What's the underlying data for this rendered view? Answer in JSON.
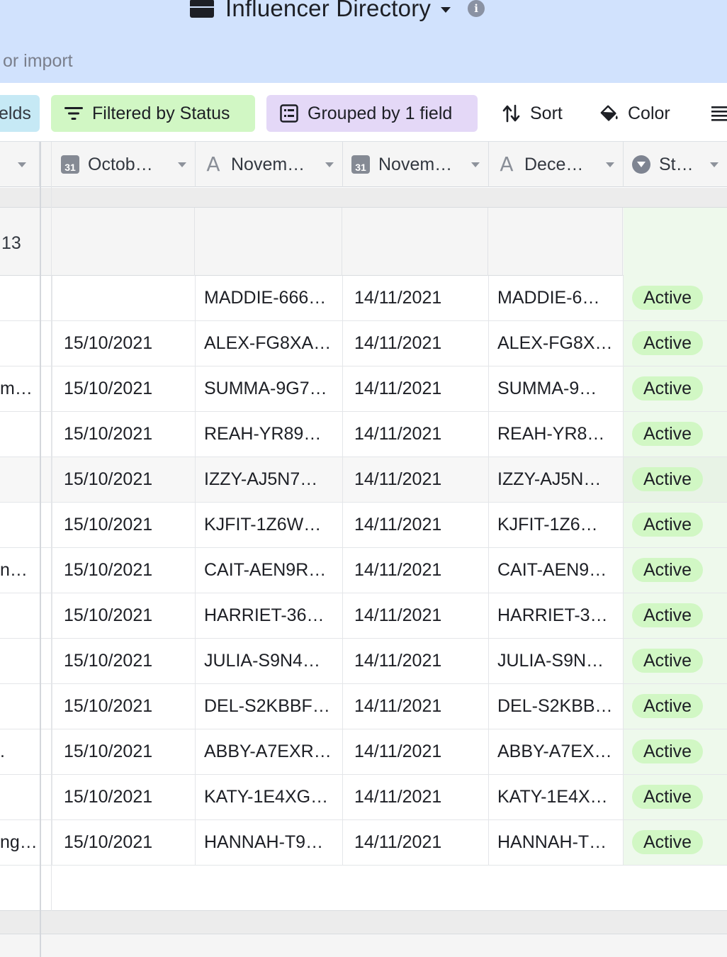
{
  "header": {
    "title": "Influencer Directory",
    "import_text": "or import"
  },
  "toolbar": {
    "fields_label": "elds",
    "filter_label": "Filtered by Status",
    "group_label": "Grouped by 1 field",
    "sort_label": "Sort",
    "color_label": "Color"
  },
  "columns": {
    "oct": "Octob…",
    "nov1": "Novem…",
    "nov2": "Novem…",
    "dec": "Dece…",
    "status": "St…"
  },
  "group": {
    "count": "13"
  },
  "rows": [
    {
      "left": "",
      "oct": "",
      "nov1": "MADDIE-666…",
      "nov2": "14/11/2021",
      "dec": "MADDIE-6…",
      "status": "Active"
    },
    {
      "left": "",
      "oct": "15/10/2021",
      "nov1": "ALEX-FG8XA…",
      "nov2": "14/11/2021",
      "dec": "ALEX-FG8X…",
      "status": "Active"
    },
    {
      "left": "m…",
      "oct": "15/10/2021",
      "nov1": "SUMMA-9G7…",
      "nov2": "14/11/2021",
      "dec": "SUMMA-9…",
      "status": "Active"
    },
    {
      "left": "",
      "oct": "15/10/2021",
      "nov1": "REAH-YR89…",
      "nov2": "14/11/2021",
      "dec": "REAH-YR8…",
      "status": "Active"
    },
    {
      "left": "",
      "oct": "15/10/2021",
      "nov1": "IZZY-AJ5N7…",
      "nov2": "14/11/2021",
      "dec": "IZZY-AJ5N…",
      "status": "Active"
    },
    {
      "left": "",
      "oct": "15/10/2021",
      "nov1": "KJFIT-1Z6W…",
      "nov2": "14/11/2021",
      "dec": "KJFIT-1Z6…",
      "status": "Active"
    },
    {
      "left": "n…",
      "oct": "15/10/2021",
      "nov1": "CAIT-AEN9R…",
      "nov2": "14/11/2021",
      "dec": "CAIT-AEN9…",
      "status": "Active"
    },
    {
      "left": "",
      "oct": "15/10/2021",
      "nov1": "HARRIET-36…",
      "nov2": "14/11/2021",
      "dec": "HARRIET-3…",
      "status": "Active"
    },
    {
      "left": "",
      "oct": "15/10/2021",
      "nov1": "JULIA-S9N4…",
      "nov2": "14/11/2021",
      "dec": "JULIA-S9N…",
      "status": "Active"
    },
    {
      "left": "",
      "oct": "15/10/2021",
      "nov1": "DEL-S2KBBF…",
      "nov2": "14/11/2021",
      "dec": "DEL-S2KBB…",
      "status": "Active"
    },
    {
      "left": ".",
      "oct": "15/10/2021",
      "nov1": "ABBY-A7EXR…",
      "nov2": "14/11/2021",
      "dec": "ABBY-A7EX…",
      "status": "Active"
    },
    {
      "left": "",
      "oct": "15/10/2021",
      "nov1": "KATY-1E4XG…",
      "nov2": "14/11/2021",
      "dec": "KATY-1E4X…",
      "status": "Active"
    },
    {
      "left": "ng…",
      "oct": "15/10/2021",
      "nov1": "HANNAH-T9…",
      "nov2": "14/11/2021",
      "dec": "HANNAH-T…",
      "status": "Active"
    }
  ],
  "colors": {
    "header_bg": "#d1e2fd",
    "filter_bg": "#d1f7c4",
    "group_bg": "#e4d8f7",
    "fields_bg": "#c6e9f5",
    "status_pill": "#d1f7c4"
  },
  "icons": {
    "base": "base-icon",
    "info": "info-icon",
    "filter": "filter-icon",
    "group": "group-icon",
    "sort": "sort-icon",
    "color": "paint-bucket-icon",
    "more": "row-height-icon",
    "date_field": "calendar-icon",
    "text_field": "text-field-icon",
    "status_field": "single-select-icon"
  }
}
